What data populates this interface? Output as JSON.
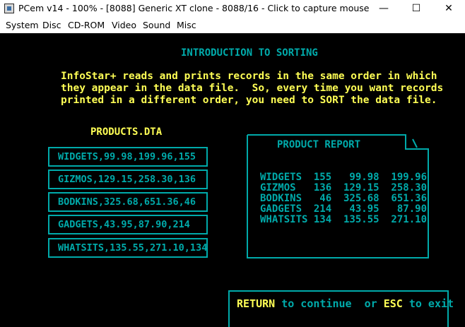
{
  "window": {
    "title": "PCem v14 - 100% - [8088] Generic XT clone - 8088/16 - Click to capture mouse",
    "minimize": "—",
    "maximize": "☐",
    "close": "✕"
  },
  "menu": [
    "System",
    "Disc",
    "CD-ROM",
    "Video",
    "Sound",
    "Misc"
  ],
  "screen": {
    "heading": "INTRODUCTION TO SORTING",
    "intro": [
      "InfoStar+ reads and prints records in the same order in which",
      "they appear in the data file.  So, every time you want records",
      "printed in a different order, you need to SORT the data file."
    ],
    "file_title": "PRODUCTS.DTA",
    "records": [
      "WIDGETS,99.98,199.96,155",
      "GIZMOS,129.15,258.30,136",
      "BODKINS,325.68,651.36,46",
      "GADGETS,43.95,87.90,214",
      "WHATSITS,135.55,271.10,134"
    ],
    "report": {
      "title": "PRODUCT REPORT",
      "rows": [
        "WIDGETS  155   99.98  199.96",
        "GIZMOS   136  129.15  258.30",
        "BODKINS   46  325.68  651.36",
        "GADGETS  214   43.95   87.90",
        "WHATSITS 134  135.55  271.10"
      ]
    },
    "footer": {
      "key1": "RETURN",
      "text1": " to continue  or ",
      "key2": "ESC",
      "text2": " to exit"
    }
  },
  "colors": {
    "cyan": "#00aaaa",
    "yellow": "#ffff55",
    "background": "#000000"
  }
}
